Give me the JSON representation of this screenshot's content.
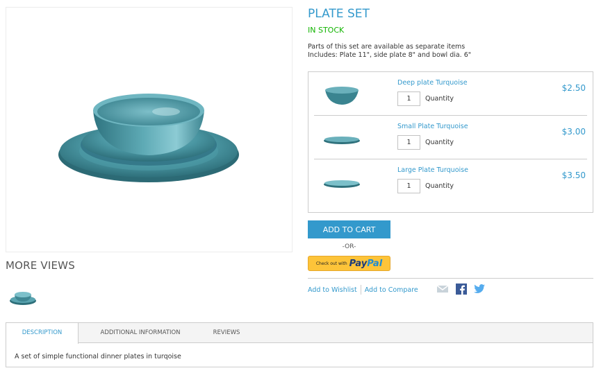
{
  "product": {
    "name": "PLATE SET",
    "stock": "IN STOCK",
    "short_description": [
      "Parts of this set are available as separate items",
      "Includes: Plate 11\", side plate 8\" and bowl dia. 6\""
    ]
  },
  "more_views": {
    "title": "MORE VIEWS"
  },
  "grouped_items": [
    {
      "name": "Deep plate Turquoise",
      "qty": "1",
      "qty_label": "Quantity",
      "price": "$2.50"
    },
    {
      "name": "Small Plate Turquoise",
      "qty": "1",
      "qty_label": "Quantity",
      "price": "$3.00"
    },
    {
      "name": "Large Plate Turquoise",
      "qty": "1",
      "qty_label": "Quantity",
      "price": "$3.50"
    }
  ],
  "actions": {
    "add_to_cart": "ADD TO CART",
    "or": "-OR-",
    "paypal_prefix": "Check out with",
    "paypal_pay": "Pay",
    "paypal_pal": "Pal",
    "wishlist": "Add to Wishlist",
    "compare": "Add to Compare"
  },
  "share_icons": [
    "email-icon",
    "facebook-icon",
    "twitter-icon"
  ],
  "tabs": {
    "items": [
      "DESCRIPTION",
      "ADDITIONAL INFORMATION",
      "REVIEWS"
    ],
    "active": 0,
    "content": "A set of simple functional dinner plates in turqoise"
  },
  "colors": {
    "accent": "#3399cc",
    "in_stock": "#11b400",
    "paypal_yellow": "#fdc439",
    "turquoise": "#3f8a96"
  }
}
